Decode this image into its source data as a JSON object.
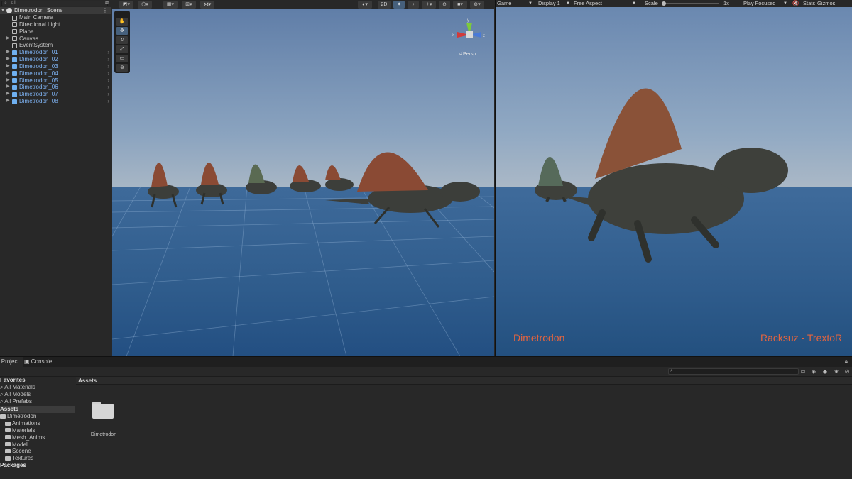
{
  "hierarchy": {
    "search_placeholder": "All",
    "scene_name": "Dimetrodon_Scene",
    "items": [
      {
        "label": "Main Camera",
        "prefab": false
      },
      {
        "label": "Directional Light",
        "prefab": false
      },
      {
        "label": "Plane",
        "prefab": false
      },
      {
        "label": "Canvas",
        "prefab": false
      },
      {
        "label": "EventSystem",
        "prefab": false
      },
      {
        "label": "Dimetrodon_01",
        "prefab": true
      },
      {
        "label": "Dimetrodon_02",
        "prefab": true
      },
      {
        "label": "Dimetrodon_03",
        "prefab": true
      },
      {
        "label": "Dimetrodon_04",
        "prefab": true
      },
      {
        "label": "Dimetrodon_05",
        "prefab": true
      },
      {
        "label": "Dimetrodon_06",
        "prefab": true
      },
      {
        "label": "Dimetrodon_07",
        "prefab": true
      },
      {
        "label": "Dimetrodon_08",
        "prefab": true
      }
    ]
  },
  "scene": {
    "toolbar": {
      "mode_2d": "2D"
    },
    "gizmo": {
      "x": "x",
      "y": "y",
      "z": "z"
    },
    "persp_label": "Persp",
    "tools": [
      "hand-tool",
      "move-tool",
      "rotate-tool",
      "scale-tool",
      "rect-tool",
      "transform-tool"
    ]
  },
  "game": {
    "tab_label": "Game",
    "display": "Display 1",
    "aspect": "Free Aspect",
    "scale_label": "Scale",
    "scale_value": "1x",
    "play_mode": "Play Focused",
    "stats": "Stats",
    "gizmos": "Gizmos",
    "title_text": "Dimetrodon",
    "credit_text": "Racksuz - TrextoR",
    "scale_fraction": 0.0
  },
  "bottom": {
    "tabs": [
      "Project",
      "Console"
    ],
    "favorites_header": "Favorites",
    "favorites": [
      "All Materials",
      "All Models",
      "All Prefabs"
    ],
    "assets_header": "Assets",
    "tree": [
      {
        "label": "Dimetrodon",
        "indent": 0
      },
      {
        "label": "Animations",
        "indent": 1
      },
      {
        "label": "Materials",
        "indent": 1
      },
      {
        "label": "Mesh_Anims",
        "indent": 1
      },
      {
        "label": "Model",
        "indent": 1
      },
      {
        "label": "Sccene",
        "indent": 1
      },
      {
        "label": "Textures",
        "indent": 1
      }
    ],
    "packages_header": "Packages",
    "breadcrumb": "Assets",
    "folder_label": "Dimetrodon"
  }
}
